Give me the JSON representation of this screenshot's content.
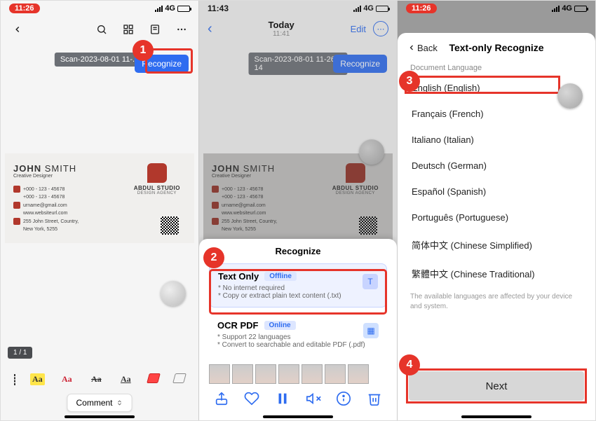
{
  "status": {
    "time_red": "11:26",
    "time_plain": "11:43",
    "network": "4G"
  },
  "screen1": {
    "scan_label": "Scan-2023-08-01 11-...",
    "recognize": "Recognize",
    "card": {
      "first": "JOHN",
      "last": "SMITH",
      "title": "Creative Designer",
      "phone1": "+000 - 123 - 45678",
      "phone2": "+000 - 123 - 45678",
      "email": "urname@gmail.com",
      "web": "www.websiteurl.com",
      "addr1": "255 John Street, Country,",
      "addr2": "New York, 5255",
      "logo": "ABDUL STUDIO",
      "logo_sub": "DESIGN AGENCY"
    },
    "page": "1 / 1",
    "comment": "Comment"
  },
  "screen2": {
    "today": "Today",
    "time": "11:41",
    "edit": "Edit",
    "scan_label": "Scan-2023-08-01 11-26-14",
    "recognize": "Recognize",
    "sheet_title": "Recognize",
    "text_only": {
      "title": "Text Only",
      "badge": "Offline",
      "b1": "* No internet required",
      "b2": "* Copy or extract plain text content (.txt)"
    },
    "ocr_pdf": {
      "title": "OCR PDF",
      "badge": "Online",
      "b1": "* Support 22 languages",
      "b2": "* Convert to searchable and editable PDF (.pdf)"
    }
  },
  "screen3": {
    "back": "Back",
    "title": "Text-only Recognize",
    "doc_lang": "Document Language",
    "langs": [
      "English (English)",
      "Français (French)",
      "Italiano (Italian)",
      "Deutsch (German)",
      "Español (Spanish)",
      "Português (Portuguese)",
      "简体中文 (Chinese Simplified)",
      "繁體中文 (Chinese Traditional)"
    ],
    "note": "The available languages are affected by your device and system.",
    "next": "Next"
  },
  "steps": {
    "s1": "1",
    "s2": "2",
    "s3": "3",
    "s4": "4"
  }
}
